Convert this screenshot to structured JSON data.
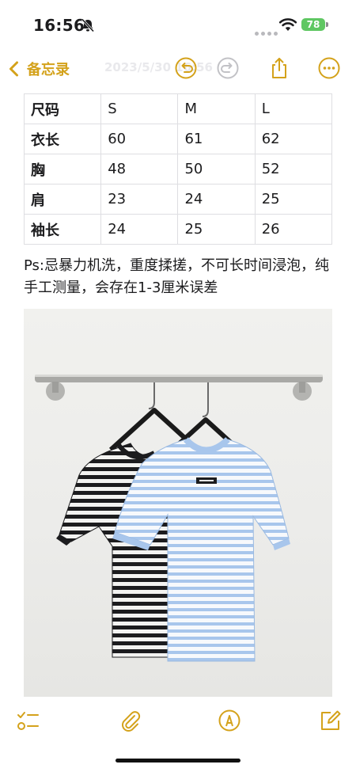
{
  "status": {
    "time": "16:56",
    "battery": "78"
  },
  "nav": {
    "back_label": "备忘录",
    "title": "2023/5/30 16:56"
  },
  "table": {
    "rows": [
      [
        "尺码",
        "S",
        "M",
        "L"
      ],
      [
        "衣长",
        "60",
        "61",
        "62"
      ],
      [
        "胸",
        "48",
        "50",
        "52"
      ],
      [
        "肩",
        "23",
        "24",
        "25"
      ],
      [
        "袖长",
        "24",
        "25",
        "26"
      ]
    ]
  },
  "note": {
    "text": "Ps:忌暴力机洗，重度揉搓，不可长时间浸泡，纯手工测量，会存在1-3厘米误差"
  },
  "colors": {
    "accent": "#d4a21b",
    "shirt_blue": "#a8c6ec",
    "shirt_black": "#1c1c1e"
  }
}
